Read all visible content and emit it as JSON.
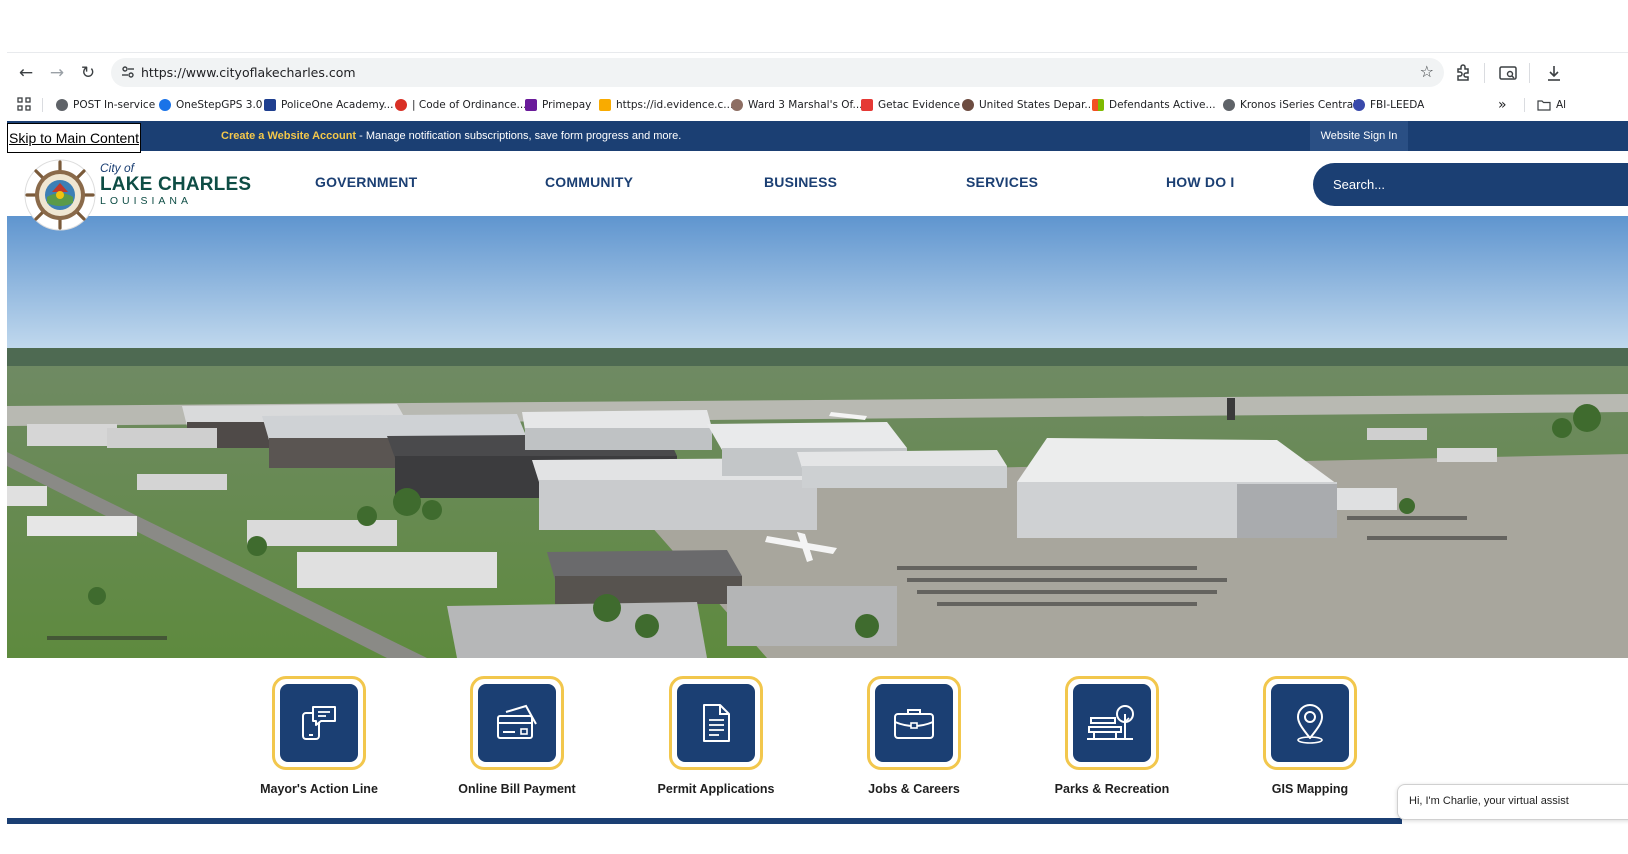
{
  "browser": {
    "url": "https://www.cityoflakecharles.com",
    "bookmarks": [
      {
        "label": "POST In-service",
        "color": "#5f6368"
      },
      {
        "label": "OneStepGPS 3.0",
        "color": "#1a73e8"
      },
      {
        "label": "PoliceOne Academy...",
        "color": "#1f3f8f"
      },
      {
        "label": "| Code of Ordinance...",
        "color": "#d93025"
      },
      {
        "label": "Primepay",
        "color": "#6a1b9a"
      },
      {
        "label": "https://id.evidence.c...",
        "color": "#f9ab00"
      },
      {
        "label": "Ward 3 Marshal's Of...",
        "color": "#8d6e63"
      },
      {
        "label": "Getac Evidence",
        "color": "#e53935"
      },
      {
        "label": "United States Depar...",
        "color": "#6d4c41"
      },
      {
        "label": "Defendants Active...",
        "color": "#f25022"
      },
      {
        "label": "Kronos iSeries Central",
        "color": "#5f6368"
      },
      {
        "label": "FBI-LEEDA",
        "color": "#3949ab"
      }
    ],
    "overflow_label": "»",
    "all_bookmarks_label": "Al"
  },
  "topbar": {
    "skip_link": "Skip to Main Content",
    "create_account": "Create a Website Account",
    "notice": " - Manage notification subscriptions, save form progress and more.",
    "signin": "Website Sign In"
  },
  "header": {
    "logo_city": "City of",
    "logo_name": "LAKE CHARLES",
    "logo_state": "LOUISIANA",
    "nav": [
      "GOVERNMENT",
      "COMMUNITY",
      "BUSINESS",
      "SERVICES",
      "HOW DO I"
    ],
    "search_placeholder": "Search..."
  },
  "quick_links": [
    {
      "label": "Mayor's Action Line",
      "icon": "phone-message-icon"
    },
    {
      "label": "Online Bill Payment",
      "icon": "credit-card-icon"
    },
    {
      "label": "Permit Applications",
      "icon": "document-icon"
    },
    {
      "label": "Jobs & Careers",
      "icon": "briefcase-icon"
    },
    {
      "label": "Parks & Recreation",
      "icon": "park-bench-tree-icon"
    },
    {
      "label": "GIS Mapping",
      "icon": "map-pin-icon"
    }
  ],
  "chat": {
    "text": "Hi, I'm Charlie, your virtual assist"
  },
  "colors": {
    "brand_navy": "#1b3f73",
    "accent_gold": "#f2c74d",
    "logo_green": "#0e4d45"
  }
}
